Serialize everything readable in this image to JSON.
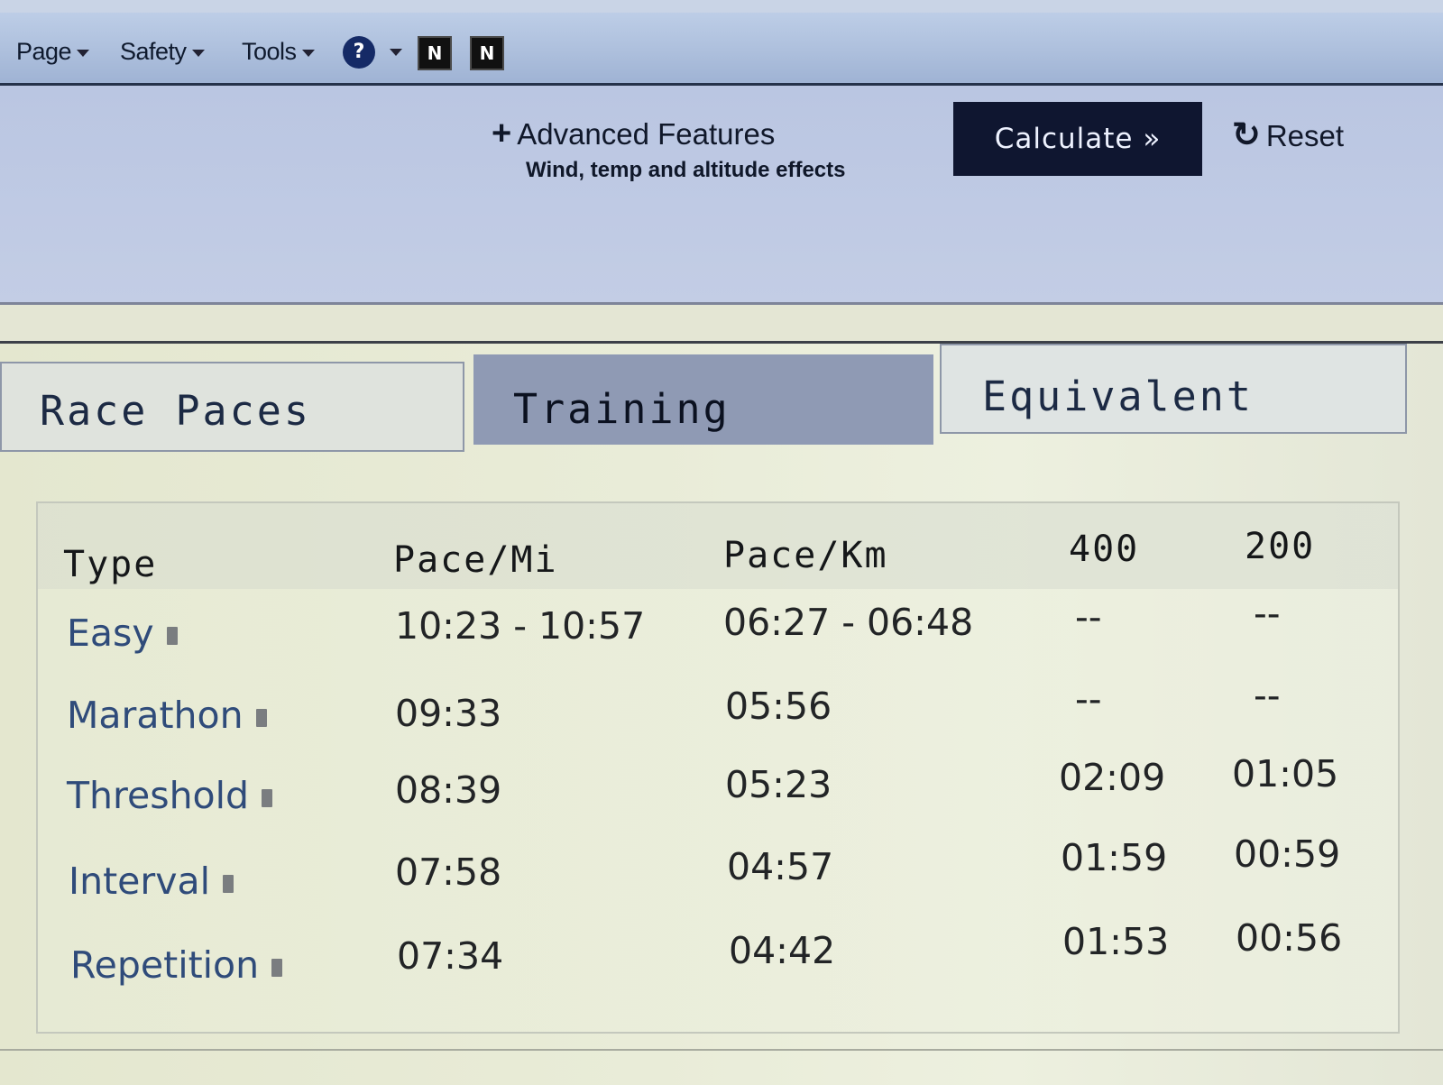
{
  "toolbar": {
    "menu": [
      {
        "label": "Page"
      },
      {
        "label": "Safety"
      },
      {
        "label": "Tools"
      }
    ],
    "help_icon": "?",
    "icons": [
      "onenote-icon",
      "onenote-linked-icon"
    ]
  },
  "actions": {
    "advanced_label": "Advanced Features",
    "advanced_sub": "Wind, temp and altitude effects",
    "calculate_label": "Calculate »",
    "reset_label": "Reset"
  },
  "tabs": [
    {
      "label": "Race Paces",
      "active": false
    },
    {
      "label": "Training",
      "active": true
    },
    {
      "label": "Equivalent",
      "active": false
    }
  ],
  "table": {
    "headers": [
      "Type",
      "Pace/Mi",
      "Pace/Km",
      "400",
      "200"
    ],
    "rows": [
      {
        "type": "Easy",
        "pace_mi": "10:23 - 10:57",
        "pace_km": "06:27 - 06:48",
        "r400": "--",
        "r200": "--"
      },
      {
        "type": "Marathon",
        "pace_mi": "09:33",
        "pace_km": "05:56",
        "r400": "--",
        "r200": "--"
      },
      {
        "type": "Threshold",
        "pace_mi": "08:39",
        "pace_km": "05:23",
        "r400": "02:09",
        "r200": "01:05"
      },
      {
        "type": "Interval",
        "pace_mi": "07:58",
        "pace_km": "04:57",
        "r400": "01:59",
        "r200": "00:59"
      },
      {
        "type": "Repetition",
        "pace_mi": "07:34",
        "pace_km": "04:42",
        "r400": "01:53",
        "r200": "00:56"
      }
    ]
  },
  "colors": {
    "toolbar_bg": "#aec0dd",
    "calculate_bg": "#0f1630",
    "active_tab": "#8f9ab4",
    "type_link": "#2f4b7a"
  }
}
